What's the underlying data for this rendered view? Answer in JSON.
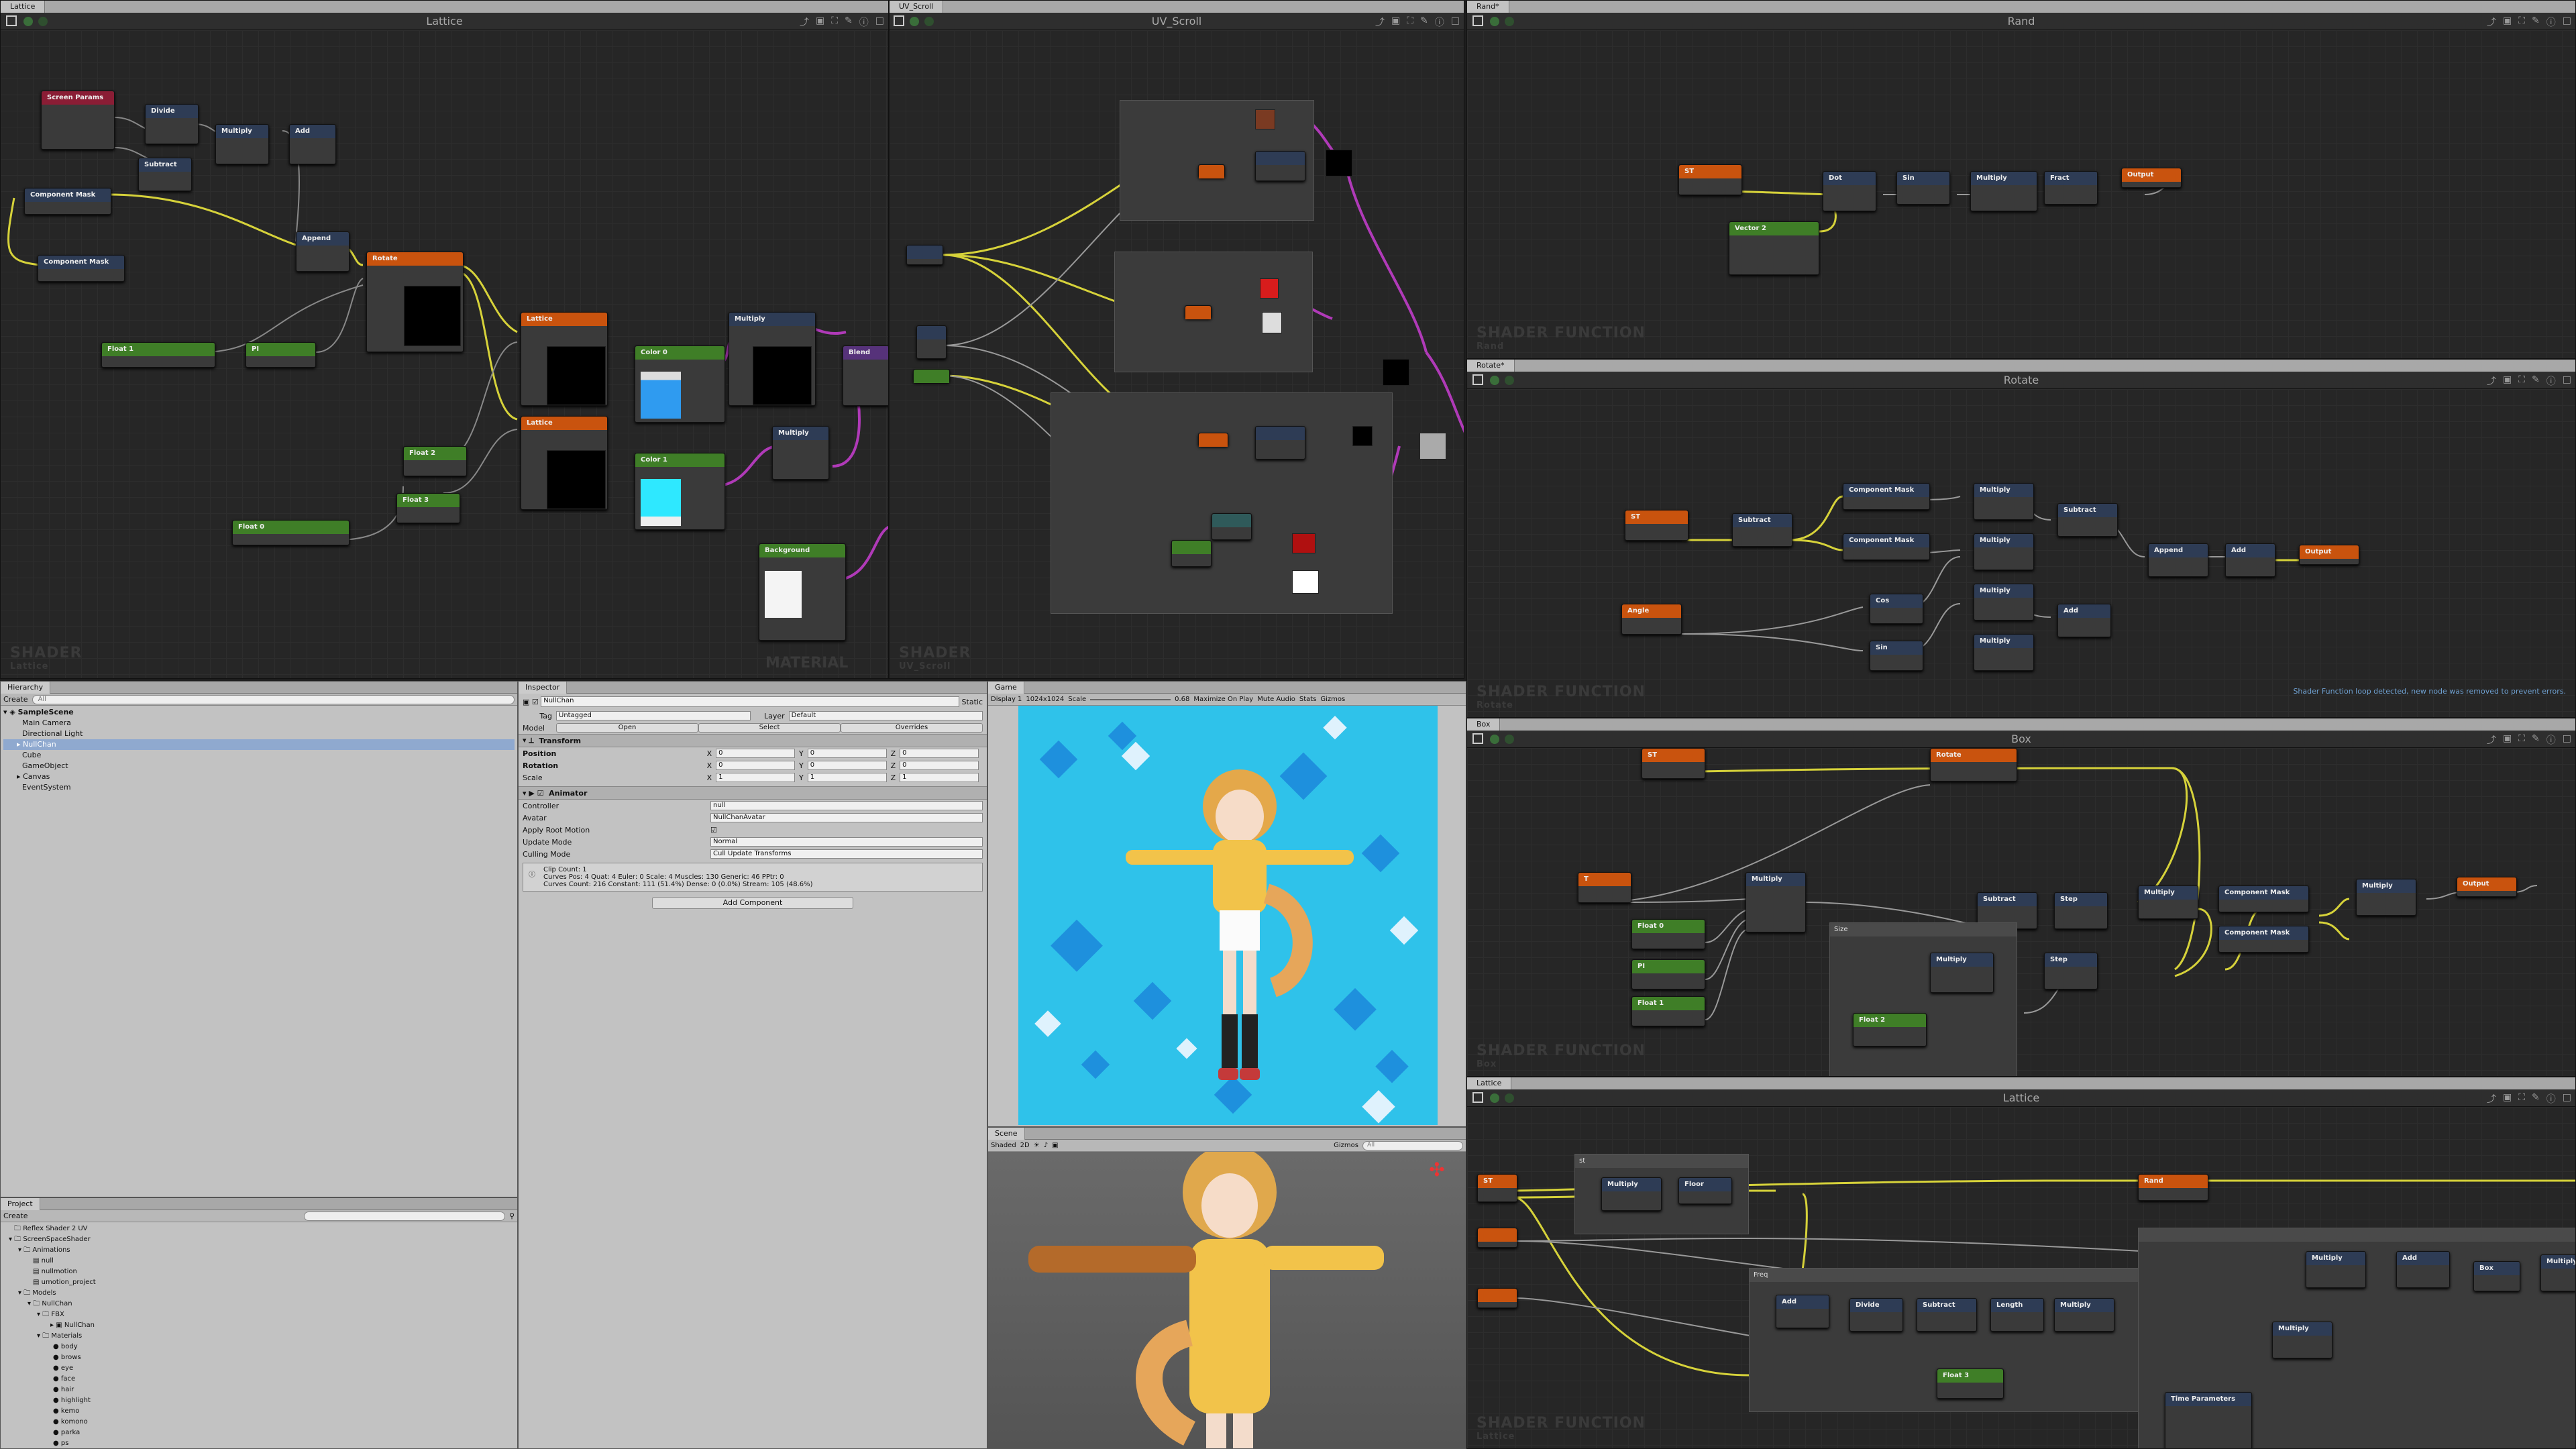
{
  "lattice_panel": {
    "tab": "Lattice",
    "title": "Lattice",
    "watermark": "SHADER",
    "watermark_sub": "Lattice",
    "watermark_right": "MATERIAL",
    "nodes": {
      "screen_params": "Screen Params",
      "divide": "Divide",
      "multiply1": "Multiply",
      "add1": "Add",
      "subtract": "Subtract",
      "component_mask1": "Component Mask",
      "component_mask2": "Component Mask",
      "append": "Append",
      "rotate": "Rotate",
      "float1": "Float 1",
      "pi": "PI",
      "lattice1": "Lattice",
      "lattice2": "Lattice",
      "color0": "Color 0",
      "color1": "Color 1",
      "multiply2": "Multiply",
      "multiply3": "Multiply",
      "float2": "Float 2",
      "float3": "Float 3",
      "float0": "Float 0",
      "background": "Background",
      "blend": "Blend"
    }
  },
  "uvscroll_panel": {
    "tab": "UV_Scroll",
    "title": "UV_Scroll",
    "watermark": "SHADER",
    "watermark_sub": "UV_Scroll"
  },
  "rand_panel": {
    "tab": "Rand*",
    "title": "Rand",
    "watermark": "SHADER FUNCTION",
    "watermark_sub": "Rand",
    "nodes": {
      "st": "ST",
      "dot": "Dot",
      "sin": "Sin",
      "multiply": "Multiply",
      "fract": "Fract",
      "output": "Output",
      "vector2": "Vector 2"
    }
  },
  "rotate_panel": {
    "tab": "Rotate*",
    "title": "Rotate",
    "watermark": "SHADER FUNCTION",
    "watermark_sub": "Rotate",
    "warning": "Shader Function loop detected, new node was removed to prevent errors.",
    "nodes": {
      "st": "ST",
      "subtract1": "Subtract",
      "cm1": "Component Mask",
      "cm2": "Component Mask",
      "m1": "Multiply",
      "m2": "Multiply",
      "m3": "Multiply",
      "m4": "Multiply",
      "subtract2": "Subtract",
      "add": "Add",
      "append": "Append",
      "add2": "Add",
      "output": "Output",
      "angle": "Angle",
      "cos": "Cos",
      "sin": "Sin"
    }
  },
  "box_panel": {
    "tab": "Box",
    "title": "Box",
    "watermark": "SHADER FUNCTION",
    "watermark_sub": "Box",
    "group_label": "Size",
    "nodes": {
      "st": "ST",
      "rotate": "Rotate",
      "t": "T",
      "multiply1": "Multiply",
      "subtract": "Subtract",
      "step1": "Step",
      "step2": "Step",
      "multiply2": "Multiply",
      "cm1": "Component Mask",
      "cm2": "Component Mask",
      "multiply3": "Multiply",
      "output": "Output",
      "float0": "Float 0",
      "pi": "PI",
      "float1": "Float 1",
      "multiply4": "Multiply",
      "float2": "Float 2"
    }
  },
  "lattice_fn_panel": {
    "tab": "Lattice",
    "title": "Lattice",
    "watermark": "SHADER FUNCTION",
    "watermark_sub": "Lattice",
    "group1_label": "st",
    "group2_label": "Freq",
    "nodes": {
      "st": "ST",
      "multiply1": "Multiply",
      "floor": "Floor",
      "rand": "Rand",
      "add": "Add",
      "divide": "Divide",
      "subtract": "Subtract",
      "length": "Length",
      "multiply2": "Multiply",
      "float3": "Float 3",
      "multiply3": "Multiply",
      "add2": "Add",
      "box": "Box",
      "multiply4": "Multiply",
      "multiply5": "Multiply",
      "time": "Time Parameters"
    }
  },
  "hierarchy": {
    "tab": "Hierarchy",
    "create": "Create",
    "search": "All",
    "items": [
      "SampleScene",
      "Main Camera",
      "Directional Light",
      "NullChan",
      "Cube",
      "GameObject",
      "Canvas",
      "EventSystem"
    ]
  },
  "project": {
    "tab": "Project",
    "create": "Create",
    "items": [
      "Reflex Shader 2 UV",
      "ScreenSpaceShader",
      "Animations",
      "null",
      "nullmotion",
      "umotion_project",
      "Models",
      "NullChan",
      "FBX",
      "NullChan",
      "Materials",
      "body",
      "brows",
      "eye",
      "face",
      "hair",
      "highlight",
      "kemo",
      "komono",
      "parka",
      "ps"
    ]
  },
  "inspector": {
    "tab": "Inspector",
    "object_name": "NullChan",
    "static_label": "Static",
    "tag_label": "Tag",
    "tag_value": "Untagged",
    "layer_label": "Layer",
    "layer_value": "Default",
    "model_label": "Model",
    "open_btn": "Open",
    "select_btn": "Select",
    "overrides_btn": "Overrides",
    "transform_title": "Transform",
    "position_label": "Position",
    "rotation_label": "Rotation",
    "scale_label": "Scale",
    "x": "X",
    "y": "Y",
    "z": "Z",
    "pos": [
      "0",
      "0",
      "0"
    ],
    "rot": [
      "0",
      "0",
      "0"
    ],
    "scl": [
      "1",
      "1",
      "1"
    ],
    "animator_title": "Animator",
    "controller_label": "Controller",
    "controller_value": "null",
    "avatar_label": "Avatar",
    "avatar_value": "NullChanAvatar",
    "root_motion_label": "Apply Root Motion",
    "update_mode_label": "Update Mode",
    "update_mode_value": "Normal",
    "culling_label": "Culling Mode",
    "culling_value": "Cull Update Transforms",
    "clip_info1": "Clip Count: 1",
    "clip_info2": "Curves Pos: 4 Quat: 4 Euler: 0 Scale: 4 Muscles: 130 Generic: 46 PPtr: 0",
    "clip_info3": "Curves Count: 216 Constant: 111 (51.4%) Dense: 0 (0.0%) Stream: 105 (48.6%)",
    "add_component": "Add Component"
  },
  "game": {
    "tab": "Game",
    "display": "Display 1",
    "resolution": "1024x1024",
    "scale_label": "Scale",
    "scale_value": "0.68",
    "maximize": "Maximize On Play",
    "mute": "Mute Audio",
    "stats": "Stats",
    "gizmos": "Gizmos"
  },
  "scene": {
    "tab": "Scene",
    "shading": "Shaded",
    "mode2d": "2D",
    "gizmos": "Gizmos",
    "search": "All"
  },
  "colors": {
    "orange_node": "#c9530e",
    "green_node": "#3f7e27",
    "blue_node": "#2e3c55",
    "purple_wire": "#b03ab8",
    "yellow_wire": "#d6d23a",
    "game_bg": "#32c3e8"
  }
}
